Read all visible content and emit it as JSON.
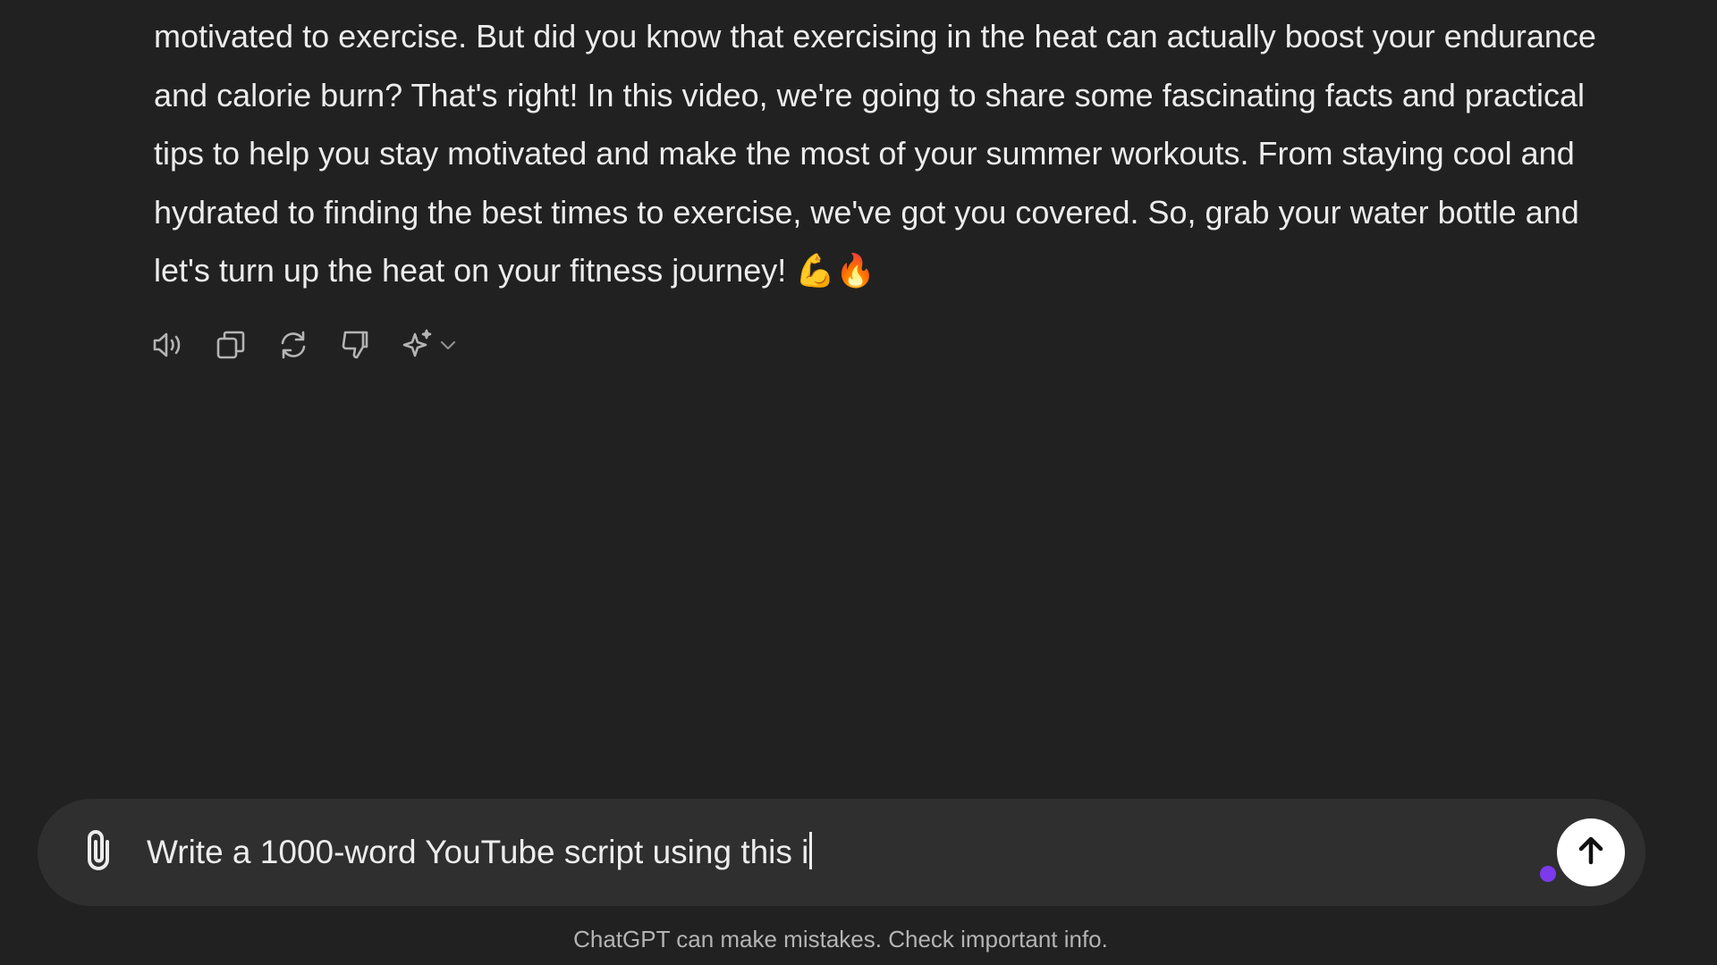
{
  "message": {
    "text": "motivated to exercise. But did you know that exercising in the heat can actually boost your endurance and calorie burn? That's right! In this video, we're going to share some fascinating facts and practical tips to help you stay motivated and make the most of your summer workouts. From staying cool and hydrated to finding the best times to exercise, we've got you covered. So, grab your water bottle and let's turn up the heat on your fitness journey! 💪🔥"
  },
  "actions": {
    "icons": [
      "speaker-icon",
      "copy-icon",
      "regenerate-icon",
      "thumbs-down-icon",
      "sparkle-icon",
      "chevron-down-icon"
    ]
  },
  "composer": {
    "value": "Write a 1000-word YouTube script using this i"
  },
  "footer": {
    "disclaimer": "ChatGPT can make mistakes. Check important info."
  },
  "colors": {
    "background": "#212121",
    "composer": "#2f2f2f",
    "text": "#ececec",
    "muted": "#b4b4b4",
    "voice_dot": "#7c3aed",
    "send_button": "#ffffff"
  }
}
